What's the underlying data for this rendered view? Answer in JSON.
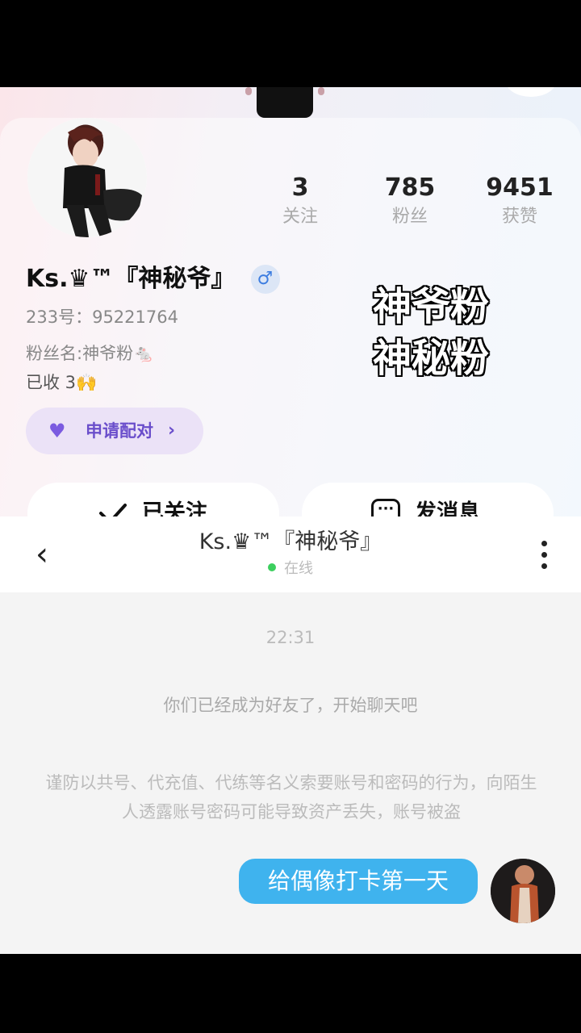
{
  "profile": {
    "stats": [
      {
        "value": "3",
        "label": "关注"
      },
      {
        "value": "785",
        "label": "粉丝"
      },
      {
        "value": "9451",
        "label": "获赞"
      }
    ],
    "name": "Ks.♛™『神秘爷』",
    "gender_symbol": "♂",
    "id_line": "233号：95221764",
    "fan_name_line": "粉丝名:神爷粉🐁",
    "received_line": "已收 3🙌",
    "pair_button": {
      "label": "申请配对",
      "chevron": "›"
    },
    "follow_button": {
      "label": "已关注",
      "icon": "check-icon"
    },
    "message_button": {
      "label": "发消息",
      "icon": "chat-bubble-icon"
    }
  },
  "overlay": {
    "line1": "神爷粉",
    "line2": "神秘粉"
  },
  "chat": {
    "back_icon": "‹",
    "title": "Ks.♛™『神秘爷』",
    "status": "在线",
    "time": "22:31",
    "system_friend": "你们已经成为好友了，开始聊天吧",
    "system_warning": "谨防以共号、代充值、代练等名义索要账号和密码的行为，向陌生人透露账号密码可能导致资产丢失，账号被盗",
    "messages": [
      {
        "text": "给偶像打卡第一天",
        "from": "me"
      }
    ]
  },
  "colors": {
    "accent_blue": "#3fb3ee",
    "pair_purple": "#6a4ecb",
    "online_green": "#3ccf5e"
  }
}
